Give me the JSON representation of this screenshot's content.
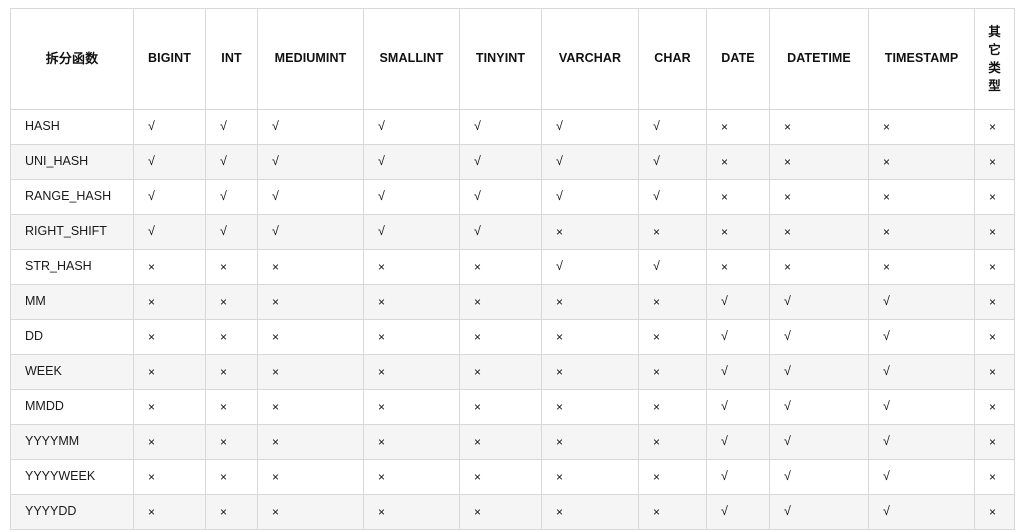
{
  "table": {
    "headers": [
      "拆分函数",
      "BIGINT",
      "INT",
      "MEDIUMINT",
      "SMALLINT",
      "TINYINT",
      "VARCHAR",
      "CHAR",
      "DATE",
      "DATETIME",
      "TIMESTAMP",
      "其它类型"
    ],
    "symbols": {
      "supported": "√",
      "unsupported": "×"
    },
    "colors": {
      "border": "#d8d8d8",
      "stripe": "#f5f5f5",
      "background": "#ffffff",
      "text": "#1a1a1a"
    },
    "rows": [
      {
        "function": "HASH",
        "striped": false,
        "values": [
          "√",
          "√",
          "√",
          "√",
          "√",
          "√",
          "√",
          "×",
          "×",
          "×",
          "×"
        ]
      },
      {
        "function": "UNI_HASH",
        "striped": true,
        "values": [
          "√",
          "√",
          "√",
          "√",
          "√",
          "√",
          "√",
          "×",
          "×",
          "×",
          "×"
        ]
      },
      {
        "function": "RANGE_HASH",
        "striped": false,
        "values": [
          "√",
          "√",
          "√",
          "√",
          "√",
          "√",
          "√",
          "×",
          "×",
          "×",
          "×"
        ]
      },
      {
        "function": "RIGHT_SHIFT",
        "striped": true,
        "values": [
          "√",
          "√",
          "√",
          "√",
          "√",
          "×",
          "×",
          "×",
          "×",
          "×",
          "×"
        ]
      },
      {
        "function": "STR_HASH",
        "striped": false,
        "values": [
          "×",
          "×",
          "×",
          "×",
          "×",
          "√",
          "√",
          "×",
          "×",
          "×",
          "×"
        ]
      },
      {
        "function": "MM",
        "striped": true,
        "values": [
          "×",
          "×",
          "×",
          "×",
          "×",
          "×",
          "×",
          "√",
          "√",
          "√",
          "×"
        ]
      },
      {
        "function": "DD",
        "striped": false,
        "values": [
          "×",
          "×",
          "×",
          "×",
          "×",
          "×",
          "×",
          "√",
          "√",
          "√",
          "×"
        ]
      },
      {
        "function": "WEEK",
        "striped": true,
        "values": [
          "×",
          "×",
          "×",
          "×",
          "×",
          "×",
          "×",
          "√",
          "√",
          "√",
          "×"
        ]
      },
      {
        "function": "MMDD",
        "striped": false,
        "values": [
          "×",
          "×",
          "×",
          "×",
          "×",
          "×",
          "×",
          "√",
          "√",
          "√",
          "×"
        ]
      },
      {
        "function": "YYYYMM",
        "striped": true,
        "values": [
          "×",
          "×",
          "×",
          "×",
          "×",
          "×",
          "×",
          "√",
          "√",
          "√",
          "×"
        ]
      },
      {
        "function": "YYYYWEEK",
        "striped": false,
        "values": [
          "×",
          "×",
          "×",
          "×",
          "×",
          "×",
          "×",
          "√",
          "√",
          "√",
          "×"
        ]
      },
      {
        "function": "YYYYDD",
        "striped": true,
        "values": [
          "×",
          "×",
          "×",
          "×",
          "×",
          "×",
          "×",
          "√",
          "√",
          "√",
          "×"
        ]
      }
    ]
  }
}
